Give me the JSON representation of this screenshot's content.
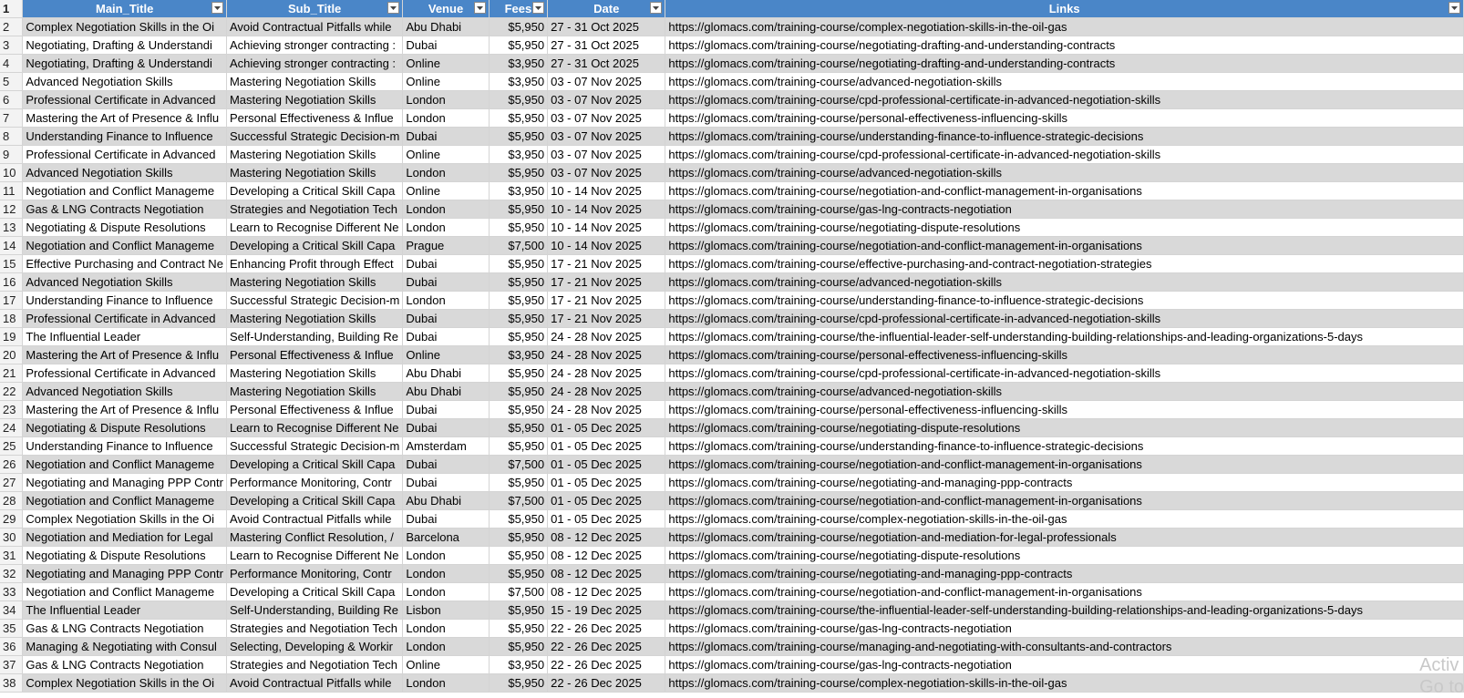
{
  "headers": [
    "Main_Title",
    "Sub_Title",
    "Venue",
    "Fees",
    "Date",
    "Links"
  ],
  "header_row_number": "1",
  "rows": [
    [
      "2",
      "Complex Negotiation Skills in the Oi",
      "Avoid Contractual Pitfalls while",
      "Abu Dhabi",
      "$5,950",
      "27 - 31 Oct 2025",
      "https://glomacs.com/training-course/complex-negotiation-skills-in-the-oil-gas"
    ],
    [
      "3",
      "Negotiating, Drafting & Understandi",
      "Achieving stronger contracting :",
      "Dubai",
      "$5,950",
      "27 - 31 Oct 2025",
      "https://glomacs.com/training-course/negotiating-drafting-and-understanding-contracts"
    ],
    [
      "4",
      "Negotiating, Drafting & Understandi",
      "Achieving stronger contracting :",
      "Online",
      "$3,950",
      "27 - 31 Oct 2025",
      "https://glomacs.com/training-course/negotiating-drafting-and-understanding-contracts"
    ],
    [
      "5",
      "Advanced Negotiation Skills",
      "Mastering Negotiation Skills",
      "Online",
      "$3,950",
      "03 - 07 Nov 2025",
      "https://glomacs.com/training-course/advanced-negotiation-skills"
    ],
    [
      "6",
      "Professional Certificate in Advanced",
      "Mastering Negotiation Skills",
      "London",
      "$5,950",
      "03 - 07 Nov 2025",
      "https://glomacs.com/training-course/cpd-professional-certificate-in-advanced-negotiation-skills"
    ],
    [
      "7",
      "Mastering the Art of Presence & Influ",
      "Personal Effectiveness & Influe",
      "London",
      "$5,950",
      "03 - 07 Nov 2025",
      "https://glomacs.com/training-course/personal-effectiveness-influencing-skills"
    ],
    [
      "8",
      "Understanding Finance to Influence",
      "Successful Strategic Decision-m",
      "Dubai",
      "$5,950",
      "03 - 07 Nov 2025",
      "https://glomacs.com/training-course/understanding-finance-to-influence-strategic-decisions"
    ],
    [
      "9",
      "Professional Certificate in Advanced",
      "Mastering Negotiation Skills",
      "Online",
      "$3,950",
      "03 - 07 Nov 2025",
      "https://glomacs.com/training-course/cpd-professional-certificate-in-advanced-negotiation-skills"
    ],
    [
      "10",
      "Advanced Negotiation Skills",
      "Mastering Negotiation Skills",
      "London",
      "$5,950",
      "03 - 07 Nov 2025",
      "https://glomacs.com/training-course/advanced-negotiation-skills"
    ],
    [
      "11",
      "Negotiation and Conflict Manageme",
      "Developing a Critical Skill Capa",
      "Online",
      "$3,950",
      "10 - 14 Nov 2025",
      "https://glomacs.com/training-course/negotiation-and-conflict-management-in-organisations"
    ],
    [
      "12",
      "Gas & LNG Contracts Negotiation",
      "Strategies and Negotiation Tech",
      "London",
      "$5,950",
      "10 - 14 Nov 2025",
      "https://glomacs.com/training-course/gas-lng-contracts-negotiation"
    ],
    [
      "13",
      "Negotiating & Dispute Resolutions",
      "Learn to Recognise Different Ne",
      "London",
      "$5,950",
      "10 - 14 Nov 2025",
      "https://glomacs.com/training-course/negotiating-dispute-resolutions"
    ],
    [
      "14",
      "Negotiation and Conflict Manageme",
      "Developing a Critical Skill Capa",
      "Prague",
      "$7,500",
      "10 - 14 Nov 2025",
      "https://glomacs.com/training-course/negotiation-and-conflict-management-in-organisations"
    ],
    [
      "15",
      "Effective Purchasing and Contract Ne",
      "Enhancing Profit through Effect",
      "Dubai",
      "$5,950",
      "17 - 21 Nov 2025",
      "https://glomacs.com/training-course/effective-purchasing-and-contract-negotiation-strategies"
    ],
    [
      "16",
      "Advanced Negotiation Skills",
      "Mastering Negotiation Skills",
      "Dubai",
      "$5,950",
      "17 - 21 Nov 2025",
      "https://glomacs.com/training-course/advanced-negotiation-skills"
    ],
    [
      "17",
      "Understanding Finance to Influence",
      "Successful Strategic Decision-m",
      "London",
      "$5,950",
      "17 - 21 Nov 2025",
      "https://glomacs.com/training-course/understanding-finance-to-influence-strategic-decisions"
    ],
    [
      "18",
      "Professional Certificate in Advanced",
      "Mastering Negotiation Skills",
      "Dubai",
      "$5,950",
      "17 - 21 Nov 2025",
      "https://glomacs.com/training-course/cpd-professional-certificate-in-advanced-negotiation-skills"
    ],
    [
      "19",
      "The Influential Leader",
      "Self-Understanding, Building Re",
      "Dubai",
      "$5,950",
      "24 - 28 Nov 2025",
      "https://glomacs.com/training-course/the-influential-leader-self-understanding-building-relationships-and-leading-organizations-5-days"
    ],
    [
      "20",
      "Mastering the Art of Presence & Influ",
      "Personal Effectiveness & Influe",
      "Online",
      "$3,950",
      "24 - 28 Nov 2025",
      "https://glomacs.com/training-course/personal-effectiveness-influencing-skills"
    ],
    [
      "21",
      "Professional Certificate in Advanced",
      "Mastering Negotiation Skills",
      "Abu Dhabi",
      "$5,950",
      "24 - 28 Nov 2025",
      "https://glomacs.com/training-course/cpd-professional-certificate-in-advanced-negotiation-skills"
    ],
    [
      "22",
      "Advanced Negotiation Skills",
      "Mastering Negotiation Skills",
      "Abu Dhabi",
      "$5,950",
      "24 - 28 Nov 2025",
      "https://glomacs.com/training-course/advanced-negotiation-skills"
    ],
    [
      "23",
      "Mastering the Art of Presence & Influ",
      "Personal Effectiveness & Influe",
      "Dubai",
      "$5,950",
      "24 - 28 Nov 2025",
      "https://glomacs.com/training-course/personal-effectiveness-influencing-skills"
    ],
    [
      "24",
      "Negotiating & Dispute Resolutions",
      "Learn to Recognise Different Ne",
      "Dubai",
      "$5,950",
      "01 - 05 Dec 2025",
      "https://glomacs.com/training-course/negotiating-dispute-resolutions"
    ],
    [
      "25",
      "Understanding Finance to Influence",
      "Successful Strategic Decision-m",
      "Amsterdam",
      "$5,950",
      "01 - 05 Dec 2025",
      "https://glomacs.com/training-course/understanding-finance-to-influence-strategic-decisions"
    ],
    [
      "26",
      "Negotiation and Conflict Manageme",
      "Developing a Critical Skill Capa",
      "Dubai",
      "$7,500",
      "01 - 05 Dec 2025",
      "https://glomacs.com/training-course/negotiation-and-conflict-management-in-organisations"
    ],
    [
      "27",
      "Negotiating and Managing PPP Contr",
      "Performance Monitoring, Contr",
      "Dubai",
      "$5,950",
      "01 - 05 Dec 2025",
      "https://glomacs.com/training-course/negotiating-and-managing-ppp-contracts"
    ],
    [
      "28",
      "Negotiation and Conflict Manageme",
      "Developing a Critical Skill Capa",
      "Abu Dhabi",
      "$7,500",
      "01 - 05 Dec 2025",
      "https://glomacs.com/training-course/negotiation-and-conflict-management-in-organisations"
    ],
    [
      "29",
      "Complex Negotiation Skills in the Oi",
      "Avoid Contractual Pitfalls while",
      "Dubai",
      "$5,950",
      "01 - 05 Dec 2025",
      "https://glomacs.com/training-course/complex-negotiation-skills-in-the-oil-gas"
    ],
    [
      "30",
      "Negotiation and Mediation for Legal",
      "Mastering Conflict Resolution, /",
      "Barcelona",
      "$5,950",
      "08 - 12 Dec 2025",
      "https://glomacs.com/training-course/negotiation-and-mediation-for-legal-professionals"
    ],
    [
      "31",
      "Negotiating & Dispute Resolutions",
      "Learn to Recognise Different Ne",
      "London",
      "$5,950",
      "08 - 12 Dec 2025",
      "https://glomacs.com/training-course/negotiating-dispute-resolutions"
    ],
    [
      "32",
      "Negotiating and Managing PPP Contr",
      "Performance Monitoring, Contr",
      "London",
      "$5,950",
      "08 - 12 Dec 2025",
      "https://glomacs.com/training-course/negotiating-and-managing-ppp-contracts"
    ],
    [
      "33",
      "Negotiation and Conflict Manageme",
      "Developing a Critical Skill Capa",
      "London",
      "$7,500",
      "08 - 12 Dec 2025",
      "https://glomacs.com/training-course/negotiation-and-conflict-management-in-organisations"
    ],
    [
      "34",
      "The Influential Leader",
      "Self-Understanding, Building Re",
      "Lisbon",
      "$5,950",
      "15 - 19 Dec 2025",
      "https://glomacs.com/training-course/the-influential-leader-self-understanding-building-relationships-and-leading-organizations-5-days"
    ],
    [
      "35",
      "Gas & LNG Contracts Negotiation",
      "Strategies and Negotiation Tech",
      "London",
      "$5,950",
      "22 - 26 Dec 2025",
      "https://glomacs.com/training-course/gas-lng-contracts-negotiation"
    ],
    [
      "36",
      "Managing & Negotiating with Consul",
      "Selecting, Developing & Workir",
      "London",
      "$5,950",
      "22 - 26 Dec 2025",
      "https://glomacs.com/training-course/managing-and-negotiating-with-consultants-and-contractors"
    ],
    [
      "37",
      "Gas & LNG Contracts Negotiation",
      "Strategies and Negotiation Tech",
      "Online",
      "$3,950",
      "22 - 26 Dec 2025",
      "https://glomacs.com/training-course/gas-lng-contracts-negotiation"
    ],
    [
      "38",
      "Complex Negotiation Skills in the Oi",
      "Avoid Contractual Pitfalls while",
      "London",
      "$5,950",
      "22 - 26 Dec 2025",
      "https://glomacs.com/training-course/complex-negotiation-skills-in-the-oil-gas"
    ]
  ],
  "watermark": {
    "line1": "Activ",
    "line2": "Go to"
  },
  "colors": {
    "header_bg": "#4a86c8",
    "band_bg": "#d9d9d9"
  }
}
